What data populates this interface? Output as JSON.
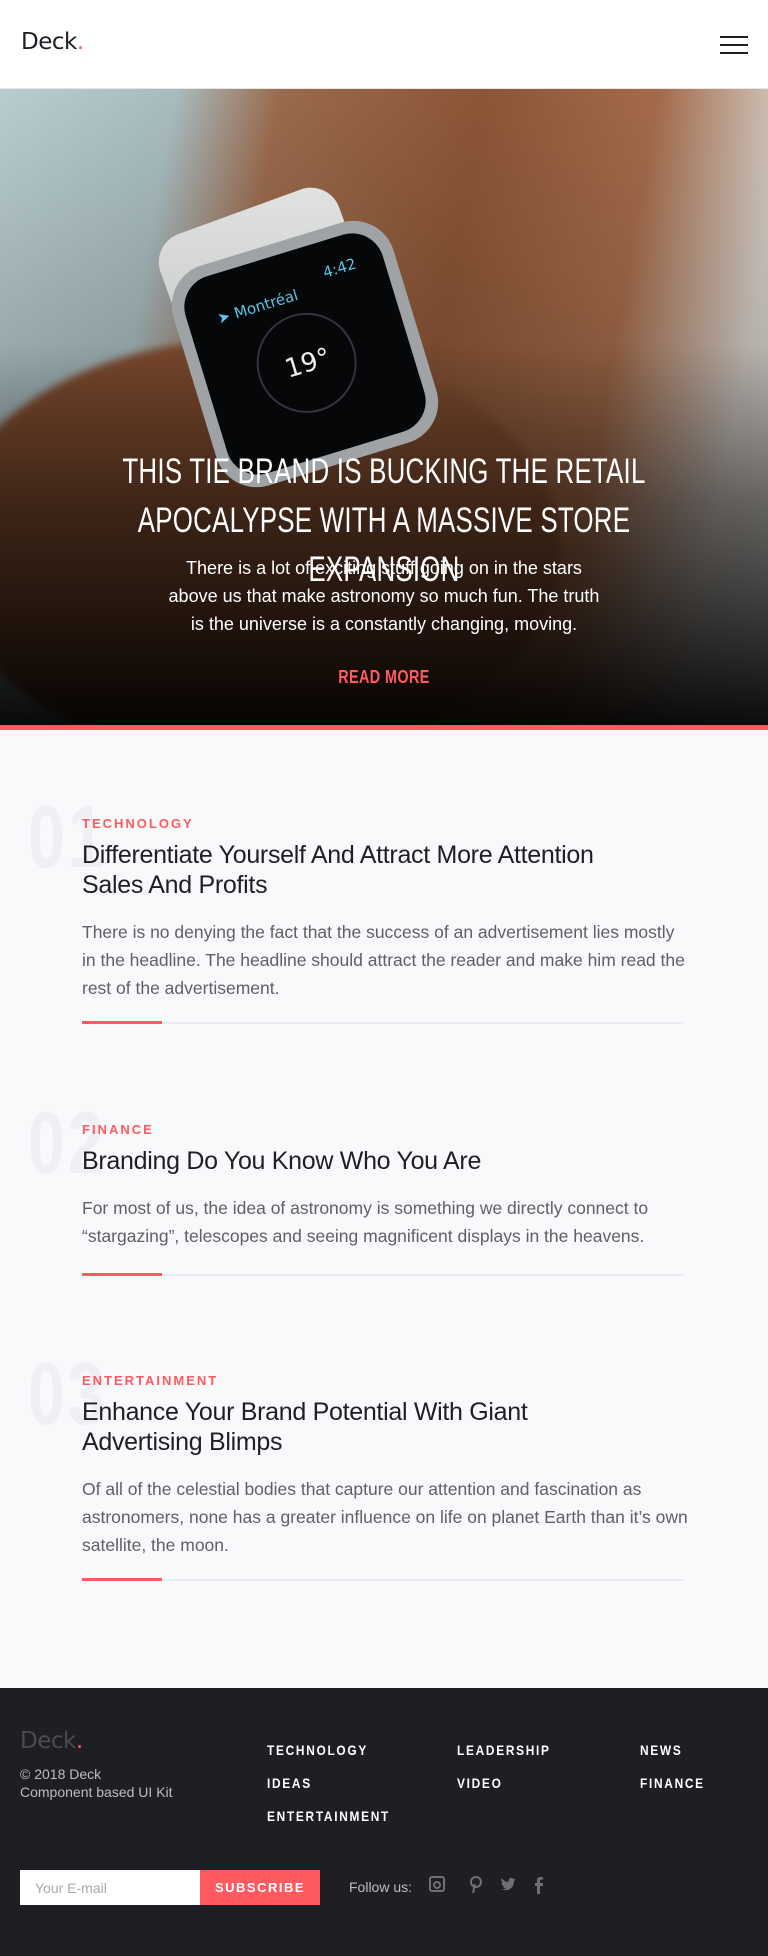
{
  "header": {
    "logo": "Deck",
    "logo_dot": "."
  },
  "hero": {
    "watch": {
      "city": "➤ Montréal",
      "time": "4:42",
      "temp": "19°"
    },
    "title_line1": "THIS TIE BRAND IS BUCKING THE RETAIL",
    "title_line2": "APOCALYPSE WITH A MASSIVE STORE EXPANSION",
    "text": "There is a lot of exciting stuff going on in the stars above us that make astronomy so much fun. The truth is the universe is a constantly changing, moving.",
    "read_more": "READ MORE"
  },
  "articles": [
    {
      "number": "01",
      "category": "TECHNOLOGY",
      "title": "Differentiate Yourself And Attract More Attention Sales And Profits",
      "body": "There is no denying the fact that the success of an advertisement lies mostly in the headline. The headline should attract the reader and make him read the rest of the advertisement."
    },
    {
      "number": "02",
      "category": "FINANCE",
      "title": "Branding Do You Know Who You Are",
      "body": "For most of us, the idea of astronomy is something we directly connect to “stargazing”, telescopes and seeing magnificent displays in the heavens."
    },
    {
      "number": "03",
      "category": "ENTERTAINMENT",
      "title": "Enhance Your Brand Potential With Giant Advertising Blimps",
      "body": "Of all of the celestial bodies that capture our attention and fascination as astronomers, none has a greater influence on life on planet Earth than it’s own satellite, the moon."
    }
  ],
  "footer": {
    "logo": "Deck",
    "logo_dot": ".",
    "copyright": "© 2018 Deck",
    "tagline": "Component based UI Kit",
    "links": [
      "TECHNOLOGY",
      "LEADERSHIP",
      "NEWS",
      "IDEAS",
      "VIDEO",
      "FINANCE",
      "ENTERTAINMENT"
    ],
    "email_placeholder": "Your E-mail",
    "subscribe": "SUBSCRIBE",
    "follow": "Follow us:",
    "social": [
      "instagram",
      "pinterest",
      "twitter",
      "facebook"
    ]
  },
  "colors": {
    "accent": "#ff5a5f",
    "dark": "#1e1f24",
    "bg": "#f8f9fb"
  }
}
